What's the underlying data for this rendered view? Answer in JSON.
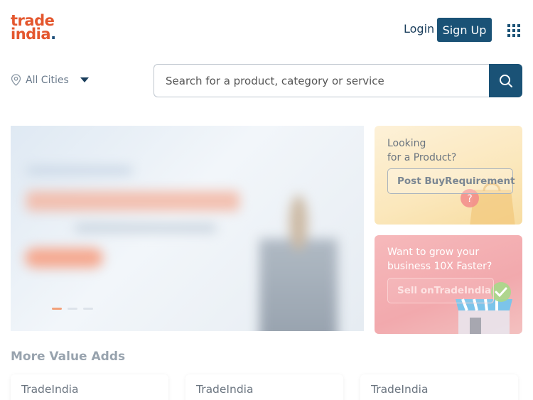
{
  "header": {
    "logo_line1": "trade",
    "logo_line2": "india",
    "logo_dot": ".",
    "login_label": "Login",
    "signup_label": "Sign Up"
  },
  "city_selector": {
    "label": "All Cities"
  },
  "search": {
    "placeholder": "Search for a product, category or service",
    "value": ""
  },
  "hero": {
    "slide_count": 3,
    "active_slide": 1
  },
  "side_cards": {
    "buy": {
      "line1": "Looking",
      "line2": "for a Product?",
      "button_label": "Post BuyRequirement"
    },
    "sell": {
      "line1": "Want to grow your",
      "line2": "business 10X Faster?",
      "button_label": "Sell onTradeIndia"
    }
  },
  "value_adds": {
    "title": "More Value Adds",
    "cards": [
      {
        "label": "TradeIndia"
      },
      {
        "label": "TradeIndia"
      },
      {
        "label": "TradeIndia"
      }
    ]
  },
  "colors": {
    "brand_orange": "#e4572e",
    "brand_navy": "#1a5276"
  }
}
